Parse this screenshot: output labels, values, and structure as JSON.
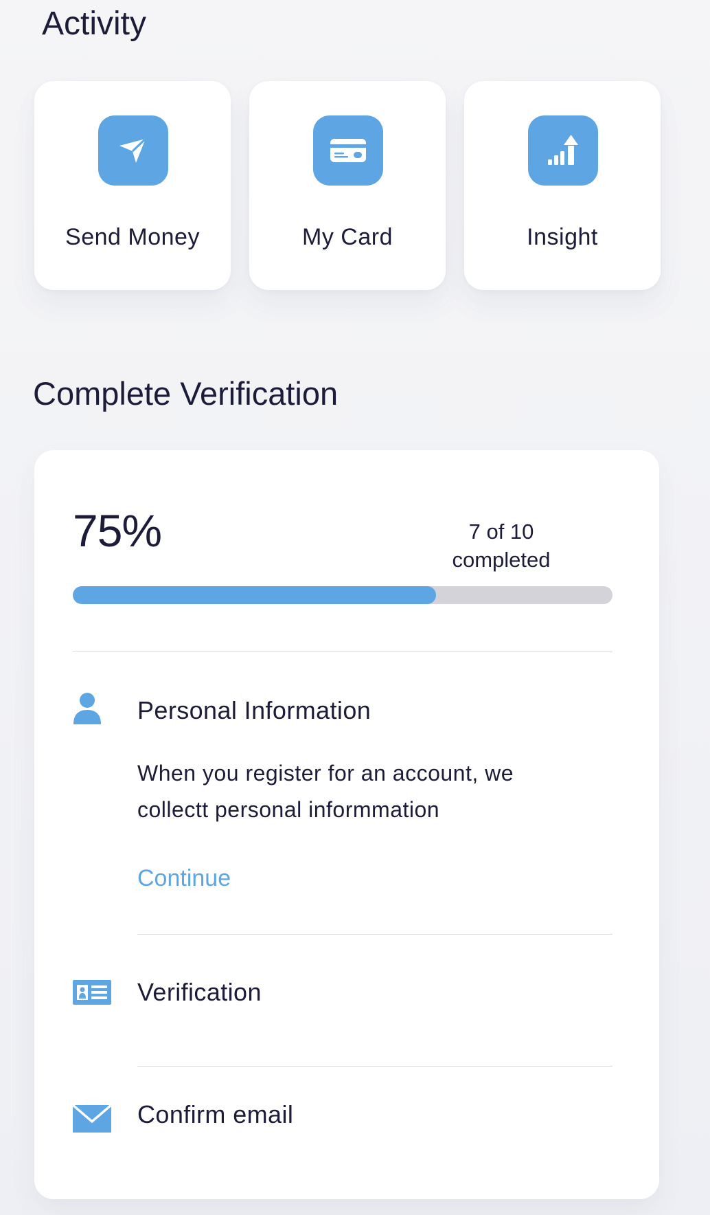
{
  "activity": {
    "title": "Activity",
    "tiles": [
      {
        "label": "Send Money",
        "icon": "paper-plane-icon"
      },
      {
        "label": "My Card",
        "icon": "credit-card-icon"
      },
      {
        "label": "Insight",
        "icon": "chart-arrow-up-icon"
      }
    ]
  },
  "verification": {
    "title": "Complete Verification",
    "progress": {
      "percent_label": "75%",
      "count_label": "7 of 10 completed",
      "bar_fill_percent": 67.3
    },
    "steps": [
      {
        "title": "Personal Information",
        "icon": "person-icon",
        "description": "When you register for an account, we collectt personal informmation",
        "action_label": "Continue"
      },
      {
        "title": "Verification",
        "icon": "id-card-icon"
      },
      {
        "title": "Confirm email",
        "icon": "envelope-icon"
      }
    ]
  },
  "colors": {
    "accent": "#5ea6e3",
    "text": "#1c1c3a",
    "track": "#d3d3d9",
    "background": "#f5f5f7",
    "card": "#ffffff"
  }
}
